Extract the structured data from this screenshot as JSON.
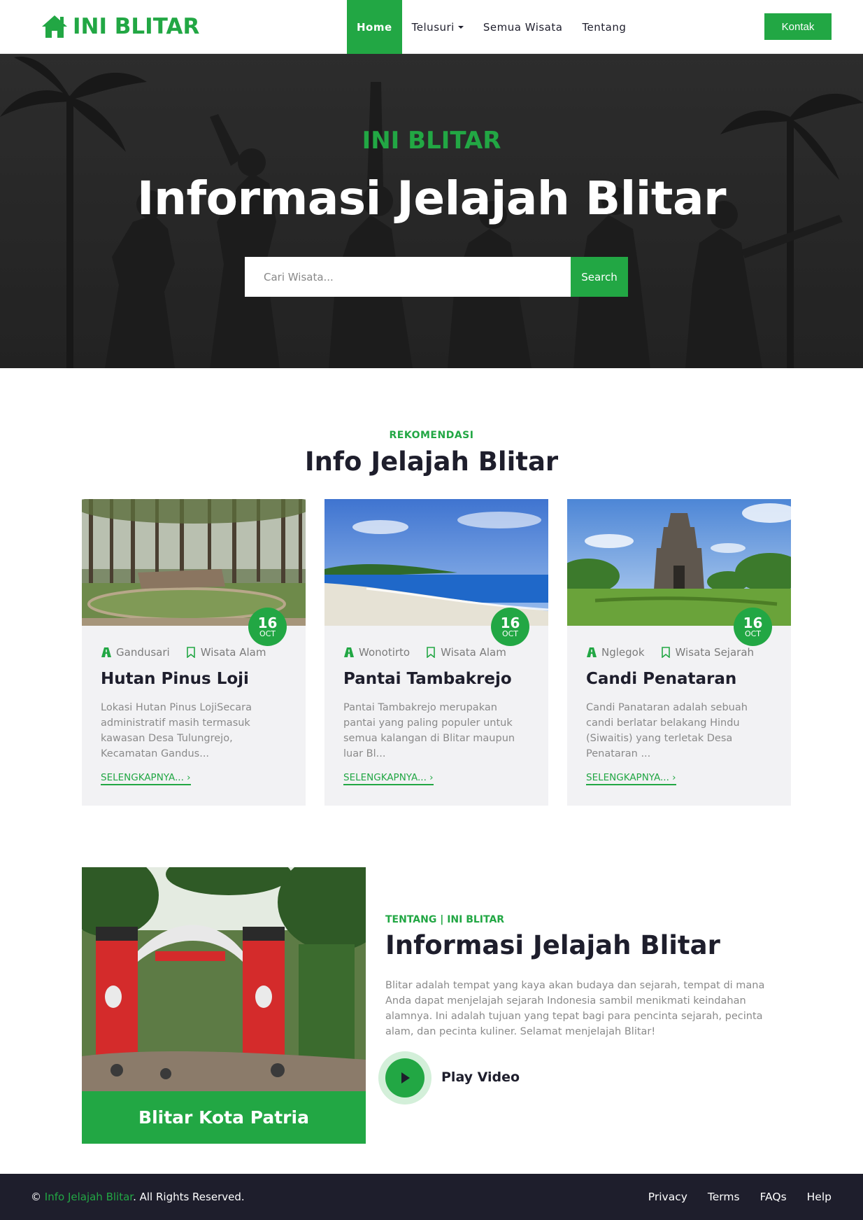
{
  "colors": {
    "accent": "#22a744",
    "dark": "#1e1e2c",
    "card_bg": "#f2f2f4",
    "muted": "#8a8a8a"
  },
  "navbar": {
    "brand": "INI BLITAR",
    "brand_icon": "home-icon",
    "links": [
      {
        "label": "Home",
        "active": true
      },
      {
        "label": "Telusuri",
        "dropdown": true
      },
      {
        "label": "Semua Wisata"
      },
      {
        "label": "Tentang"
      }
    ],
    "contact_label": "Kontak"
  },
  "hero": {
    "eyebrow": "INI BLITAR",
    "title": "Informasi Jelajah Blitar",
    "search_placeholder": "Cari Wisata...",
    "search_button": "Search"
  },
  "recommendation": {
    "eyebrow": "REKOMENDASI",
    "title": "Info Jelajah Blitar",
    "cards": [
      {
        "day": "16",
        "month": "OCT",
        "location": "Gandusari",
        "category": "Wisata Alam",
        "title": "Hutan Pinus Loji",
        "description": "Lokasi Hutan Pinus LojiSecara administratif masih termasuk kawasan Desa Tulungrejo, Kecamatan Gandus...",
        "read_more": "SELENGKAPNYA..."
      },
      {
        "day": "16",
        "month": "OCT",
        "location": "Wonotirto",
        "category": "Wisata Alam",
        "title": "Pantai Tambakrejo",
        "description": "Pantai Tambakrejo merupakan pantai yang paling populer untuk semua kalangan di Blitar maupun luar Bl...",
        "read_more": "SELENGKAPNYA..."
      },
      {
        "day": "16",
        "month": "OCT",
        "location": "Nglegok",
        "category": "Wisata Sejarah",
        "title": "Candi Penataran",
        "description": "Candi Panataran adalah sebuah candi berlatar belakang Hindu (Siwaitis) yang terletak Desa Penataran ...",
        "read_more": "SELENGKAPNYA..."
      }
    ]
  },
  "about": {
    "image_caption": "Blitar Kota Patria",
    "eyebrow": "TENTANG | INI BLITAR",
    "title": "Informasi Jelajah Blitar",
    "description": "Blitar adalah tempat yang kaya akan budaya dan sejarah, tempat di mana Anda dapat menjelajah sejarah Indonesia sambil menikmati keindahan alamnya. Ini adalah tujuan yang tepat bagi para pencinta sejarah, pecinta alam, dan pecinta kuliner. Selamat menjelajah Blitar!",
    "play_label": "Play Video"
  },
  "footer": {
    "copyright_symbol": "©",
    "copyright_site": "Info Jelajah Blitar",
    "copyright_suffix": ". All Rights Reserved.",
    "links": [
      "Privacy",
      "Terms",
      "FAQs",
      "Help"
    ]
  }
}
